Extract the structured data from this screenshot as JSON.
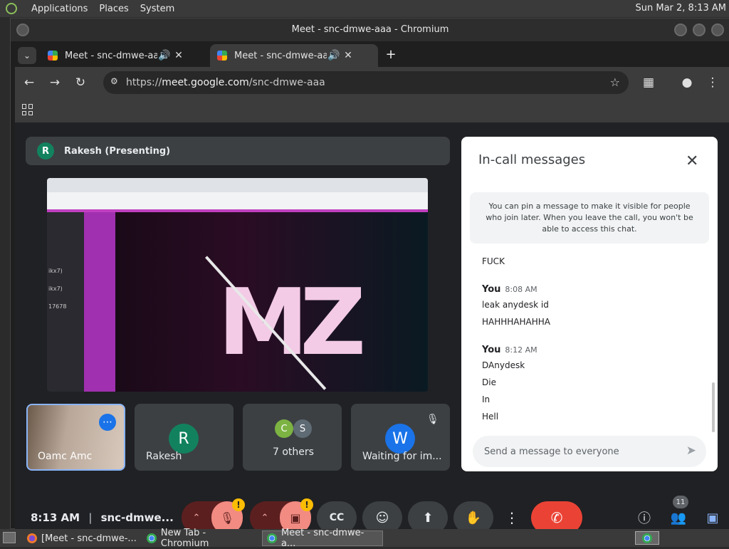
{
  "system_panel": {
    "menus": [
      "Applications",
      "Places",
      "System"
    ],
    "clock": "Sun Mar  2,  8:13 AM"
  },
  "window": {
    "title": "Meet - snc-dmwe-aaa - Chromium"
  },
  "tabs": [
    {
      "label": "Meet - snc-dmwe-aaa"
    },
    {
      "label": "Meet - snc-dmwe-aaa"
    }
  ],
  "toolbar": {
    "url_scheme": "https://",
    "url_host": "meet.google.com",
    "url_path": "/snc-dmwe-aaa"
  },
  "presenter": {
    "initial": "R",
    "label": "Rakesh (Presenting)"
  },
  "shared_screen": {
    "logo_text": "MZ",
    "side_labels": [
      "ikx7)",
      "ikx7)",
      "17678"
    ]
  },
  "tiles": [
    {
      "name": "Oamc Amc"
    },
    {
      "initial": "R",
      "name": "Rakesh"
    },
    {
      "initials": [
        "C",
        "S"
      ],
      "name": "7 others"
    },
    {
      "initial": "W",
      "name": "Waiting for im..."
    }
  ],
  "chat": {
    "title": "In-call messages",
    "pin_note": "You can pin a message to make it visible for people who join later. When you leave the call, you won't be able to access this chat.",
    "messages": [
      {
        "text": "FUCK"
      },
      {
        "sender": "You",
        "time": "8:08 AM",
        "lines": [
          "leak anydesk id",
          "HAHHHAHAHHA"
        ]
      },
      {
        "sender": "You",
        "time": "8:12 AM",
        "lines": [
          "DAnydesk",
          "Die",
          "In",
          "Hell"
        ]
      }
    ],
    "input_placeholder": "Send a message to everyone"
  },
  "bottom_bar": {
    "time": "8:13 AM",
    "meeting_code": "snc-dmwe...",
    "alert_badge": "!",
    "participants_count": "11"
  },
  "taskbar": {
    "items": [
      "[Meet - snc-dmwe-...",
      "New Tab - Chromium",
      "Meet - snc-dmwe-a..."
    ]
  },
  "colors": {
    "meet_bg": "#202124",
    "end_call": "#ea4335",
    "muted_control": "#f28b82",
    "accent_blue": "#1a73e8"
  }
}
